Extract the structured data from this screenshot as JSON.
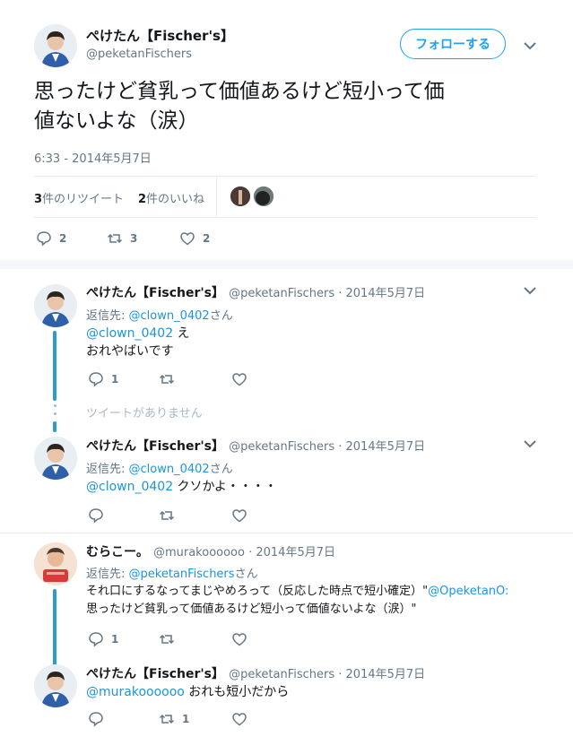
{
  "main_tweet": {
    "name": "ぺけたん【Fischer's】",
    "handle": "@peketanFischers",
    "follow_label": "フォローする",
    "text_line1": "思ったけど貧乳って価値あるけど短小って価",
    "text_line2": "値ないよな（涙）",
    "timestamp": "6:33 - 2014年5月7日",
    "retweets_num": "3",
    "retweets_label": "件のリツイート",
    "likes_num": "2",
    "likes_label": "件のいいね",
    "reply_count": "2",
    "retweet_count": "3",
    "like_count": "2"
  },
  "replies": [
    {
      "name": "ぺけたん【Fischer's】",
      "meta": "@peketanFischers · 2014年5月7日",
      "reply_to_prefix": "返信先: ",
      "reply_to_handle": "@clown_0402",
      "reply_to_suffix": "さん",
      "mention": "@clown_0402",
      "text_after_mention": " え",
      "text_line2": "おれやばいです",
      "reply_count": "1",
      "retweet_count": "",
      "like_count": ""
    },
    {
      "name": "ぺけたん【Fischer's】",
      "meta": "@peketanFischers · 2014年5月7日",
      "reply_to_prefix": "返信先: ",
      "reply_to_handle": "@clown_0402",
      "reply_to_suffix": "さん",
      "mention": "@clown_0402",
      "text_after_mention": " クソかよ・・・・",
      "reply_count": "",
      "retweet_count": "",
      "like_count": ""
    },
    {
      "name": "むらこー。",
      "meta": "@murakoooooo · 2014年5月7日",
      "reply_to_prefix": "返信先: ",
      "reply_to_handle": "@peketanFischers",
      "reply_to_suffix": "さん",
      "text_line1_a": "それ口にするなってまじやめろって（反応した時点で短小確定）\"",
      "text_line1_link": "@OpeketanO:",
      "text_line2": "思ったけど貧乳って価値あるけど短小って価値ないよな（涙）\"",
      "reply_count": "1",
      "retweet_count": "",
      "like_count": ""
    },
    {
      "name": "ぺけたん【Fischer's】",
      "meta": "@peketanFischers · 2014年5月7日",
      "mention": "@murakoooooo",
      "text_after_mention": " おれも短小だから",
      "reply_count": "",
      "retweet_count": "1",
      "like_count": ""
    }
  ],
  "unavailable_text": "ツイートがありません",
  "colors": {
    "link": "#1b95e0",
    "thread": "#2b9bd2",
    "muted": "#657786"
  }
}
